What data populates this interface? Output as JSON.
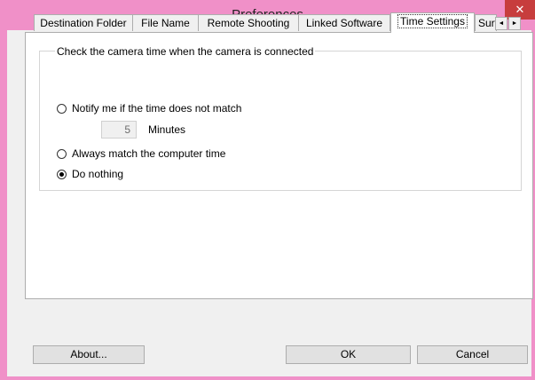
{
  "window": {
    "title": "Preferences",
    "close_glyph": "✕"
  },
  "tabs": [
    {
      "label": "Destination Folder",
      "active": false
    },
    {
      "label": "File Name",
      "active": false
    },
    {
      "label": "Remote Shooting",
      "active": false
    },
    {
      "label": "Linked Software",
      "active": false
    },
    {
      "label": "Time Settings",
      "active": true
    },
    {
      "label": "Surv",
      "active": false
    }
  ],
  "tab_scroll": {
    "left_glyph": "◄",
    "right_glyph": "►"
  },
  "time_settings": {
    "group_label": "Check the camera time when the camera is connected",
    "options": [
      {
        "label": "Notify me if the time does not match",
        "checked": false
      },
      {
        "label": "Always match the computer time",
        "checked": false
      },
      {
        "label": "Do nothing",
        "checked": true
      }
    ],
    "minutes_value": "5",
    "minutes_label": "Minutes"
  },
  "buttons": {
    "about": "About...",
    "ok": "OK",
    "cancel": "Cancel"
  }
}
